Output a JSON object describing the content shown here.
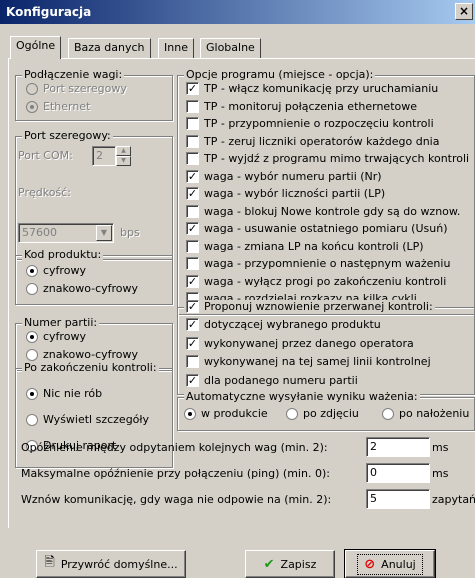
{
  "window": {
    "title": "Konfiguracja",
    "close": "×"
  },
  "tabs": [
    "Ogólne",
    "Baza danych",
    "Inne",
    "Globalne"
  ],
  "podlaczenie": {
    "title": "Podłączenie wagi:",
    "options": [
      "Port szeregowy",
      "Ethernet"
    ],
    "selected": 1
  },
  "port": {
    "title": "Port szeregowy:",
    "com_label": "Port COM:",
    "com_value": "2",
    "speed_label": "Prędkość:",
    "speed_value": "57600",
    "bps": "bps"
  },
  "kod": {
    "title": "Kod produktu:",
    "options": [
      "cyfrowy",
      "znakowo-cyfrowy"
    ],
    "selected": 0
  },
  "numer": {
    "title": "Numer partii:",
    "options": [
      "cyfrowy",
      "znakowo-cyfrowy"
    ],
    "selected": 0
  },
  "po": {
    "title": "Po zakończeniu kontroli:",
    "options": [
      "Nic nie rób",
      "Wyświetl szczegóły",
      "Drukuj raport"
    ],
    "selected": 0
  },
  "opcje": {
    "title": "Opcje programu (miejsce - opcja):",
    "items": [
      {
        "label": "TP - włącz komunikację przy uruchamianiu",
        "checked": true
      },
      {
        "label": "TP - monitoruj połączenia ethernetowe",
        "checked": false
      },
      {
        "label": "TP - przypomnienie o rozpoczęciu kontroli",
        "checked": false
      },
      {
        "label": "TP - zeruj liczniki operatorów każdego dnia",
        "checked": false
      },
      {
        "label": "TP - wyjdź z programu mimo trwających kontroli",
        "checked": false
      },
      {
        "label": "waga - wybór numeru partii (Nr)",
        "checked": true
      },
      {
        "label": "waga - wybór liczności partii (LP)",
        "checked": true
      },
      {
        "label": "waga - blokuj Nowe kontrole gdy są do wznow.",
        "checked": false
      },
      {
        "label": "waga - usuwanie ostatniego pomiaru (Usuń)",
        "checked": true
      },
      {
        "label": "waga - zmiana LP na końcu kontroli (LP)",
        "checked": false
      },
      {
        "label": "waga - przypomnienie o następnym ważeniu",
        "checked": false
      },
      {
        "label": "waga - wyłącz progi po zakończeniu kontroli",
        "checked": true
      },
      {
        "label": "waga - rozdzielaj rozkazy na kilka cykli",
        "checked": false
      }
    ]
  },
  "proponuj": {
    "title": "Proponuj wznowienie przerwanej kontroli:",
    "checked": true,
    "items": [
      {
        "label": "dotyczącej wybranego produktu",
        "checked": true
      },
      {
        "label": "wykonywanej przez danego operatora",
        "checked": true
      },
      {
        "label": "wykonywanej na tej samej linii kontrolnej",
        "checked": false
      },
      {
        "label": "dla podanego numeru partii",
        "checked": true
      }
    ]
  },
  "auto": {
    "title": "Automatyczne wysyłanie wyniku ważenia:",
    "options": [
      "w produkcie",
      "po zdjęciu",
      "po nałożeniu"
    ],
    "selected": 0
  },
  "bottom": {
    "rows": [
      {
        "label": "Opóźnienie między odpytaniem kolejnych wag (min. 2):",
        "value": "2",
        "unit": "ms"
      },
      {
        "label": "Maksymalne opóźnienie przy połączeniu (ping) (min. 0):",
        "value": "0",
        "unit": "ms"
      },
      {
        "label": "Wznów komunikację, gdy waga nie odpowie na (min. 2):",
        "value": "5",
        "unit": "zapytań"
      }
    ]
  },
  "buttons": {
    "restore": "Przywróć domyślne...",
    "save": "Zapisz",
    "cancel": "Anuluj"
  },
  "colors": {
    "title_start": "#0a246a",
    "title_end": "#a6caf0",
    "face": "#d4d0c8"
  }
}
